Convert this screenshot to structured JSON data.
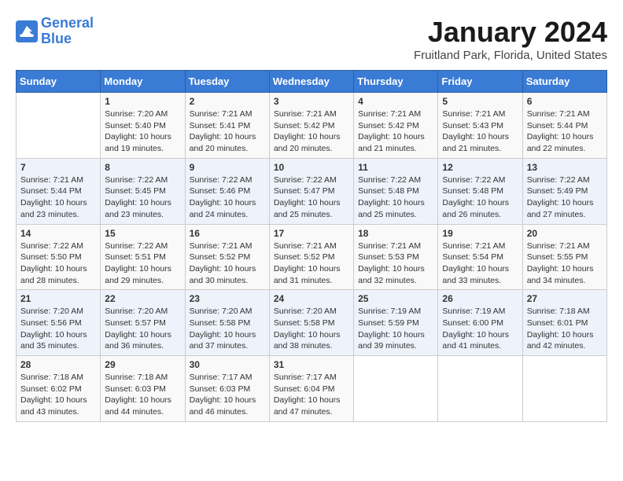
{
  "app": {
    "logo_line1": "General",
    "logo_line2": "Blue"
  },
  "header": {
    "title": "January 2024",
    "subtitle": "Fruitland Park, Florida, United States"
  },
  "days_of_week": [
    "Sunday",
    "Monday",
    "Tuesday",
    "Wednesday",
    "Thursday",
    "Friday",
    "Saturday"
  ],
  "weeks": [
    [
      {
        "day": "",
        "info": ""
      },
      {
        "day": "1",
        "info": "Sunrise: 7:20 AM\nSunset: 5:40 PM\nDaylight: 10 hours\nand 19 minutes."
      },
      {
        "day": "2",
        "info": "Sunrise: 7:21 AM\nSunset: 5:41 PM\nDaylight: 10 hours\nand 20 minutes."
      },
      {
        "day": "3",
        "info": "Sunrise: 7:21 AM\nSunset: 5:42 PM\nDaylight: 10 hours\nand 20 minutes."
      },
      {
        "day": "4",
        "info": "Sunrise: 7:21 AM\nSunset: 5:42 PM\nDaylight: 10 hours\nand 21 minutes."
      },
      {
        "day": "5",
        "info": "Sunrise: 7:21 AM\nSunset: 5:43 PM\nDaylight: 10 hours\nand 21 minutes."
      },
      {
        "day": "6",
        "info": "Sunrise: 7:21 AM\nSunset: 5:44 PM\nDaylight: 10 hours\nand 22 minutes."
      }
    ],
    [
      {
        "day": "7",
        "info": "Sunrise: 7:21 AM\nSunset: 5:44 PM\nDaylight: 10 hours\nand 23 minutes."
      },
      {
        "day": "8",
        "info": "Sunrise: 7:22 AM\nSunset: 5:45 PM\nDaylight: 10 hours\nand 23 minutes."
      },
      {
        "day": "9",
        "info": "Sunrise: 7:22 AM\nSunset: 5:46 PM\nDaylight: 10 hours\nand 24 minutes."
      },
      {
        "day": "10",
        "info": "Sunrise: 7:22 AM\nSunset: 5:47 PM\nDaylight: 10 hours\nand 25 minutes."
      },
      {
        "day": "11",
        "info": "Sunrise: 7:22 AM\nSunset: 5:48 PM\nDaylight: 10 hours\nand 25 minutes."
      },
      {
        "day": "12",
        "info": "Sunrise: 7:22 AM\nSunset: 5:48 PM\nDaylight: 10 hours\nand 26 minutes."
      },
      {
        "day": "13",
        "info": "Sunrise: 7:22 AM\nSunset: 5:49 PM\nDaylight: 10 hours\nand 27 minutes."
      }
    ],
    [
      {
        "day": "14",
        "info": "Sunrise: 7:22 AM\nSunset: 5:50 PM\nDaylight: 10 hours\nand 28 minutes."
      },
      {
        "day": "15",
        "info": "Sunrise: 7:22 AM\nSunset: 5:51 PM\nDaylight: 10 hours\nand 29 minutes."
      },
      {
        "day": "16",
        "info": "Sunrise: 7:21 AM\nSunset: 5:52 PM\nDaylight: 10 hours\nand 30 minutes."
      },
      {
        "day": "17",
        "info": "Sunrise: 7:21 AM\nSunset: 5:52 PM\nDaylight: 10 hours\nand 31 minutes."
      },
      {
        "day": "18",
        "info": "Sunrise: 7:21 AM\nSunset: 5:53 PM\nDaylight: 10 hours\nand 32 minutes."
      },
      {
        "day": "19",
        "info": "Sunrise: 7:21 AM\nSunset: 5:54 PM\nDaylight: 10 hours\nand 33 minutes."
      },
      {
        "day": "20",
        "info": "Sunrise: 7:21 AM\nSunset: 5:55 PM\nDaylight: 10 hours\nand 34 minutes."
      }
    ],
    [
      {
        "day": "21",
        "info": "Sunrise: 7:20 AM\nSunset: 5:56 PM\nDaylight: 10 hours\nand 35 minutes."
      },
      {
        "day": "22",
        "info": "Sunrise: 7:20 AM\nSunset: 5:57 PM\nDaylight: 10 hours\nand 36 minutes."
      },
      {
        "day": "23",
        "info": "Sunrise: 7:20 AM\nSunset: 5:58 PM\nDaylight: 10 hours\nand 37 minutes."
      },
      {
        "day": "24",
        "info": "Sunrise: 7:20 AM\nSunset: 5:58 PM\nDaylight: 10 hours\nand 38 minutes."
      },
      {
        "day": "25",
        "info": "Sunrise: 7:19 AM\nSunset: 5:59 PM\nDaylight: 10 hours\nand 39 minutes."
      },
      {
        "day": "26",
        "info": "Sunrise: 7:19 AM\nSunset: 6:00 PM\nDaylight: 10 hours\nand 41 minutes."
      },
      {
        "day": "27",
        "info": "Sunrise: 7:18 AM\nSunset: 6:01 PM\nDaylight: 10 hours\nand 42 minutes."
      }
    ],
    [
      {
        "day": "28",
        "info": "Sunrise: 7:18 AM\nSunset: 6:02 PM\nDaylight: 10 hours\nand 43 minutes."
      },
      {
        "day": "29",
        "info": "Sunrise: 7:18 AM\nSunset: 6:03 PM\nDaylight: 10 hours\nand 44 minutes."
      },
      {
        "day": "30",
        "info": "Sunrise: 7:17 AM\nSunset: 6:03 PM\nDaylight: 10 hours\nand 46 minutes."
      },
      {
        "day": "31",
        "info": "Sunrise: 7:17 AM\nSunset: 6:04 PM\nDaylight: 10 hours\nand 47 minutes."
      },
      {
        "day": "",
        "info": ""
      },
      {
        "day": "",
        "info": ""
      },
      {
        "day": "",
        "info": ""
      }
    ]
  ]
}
